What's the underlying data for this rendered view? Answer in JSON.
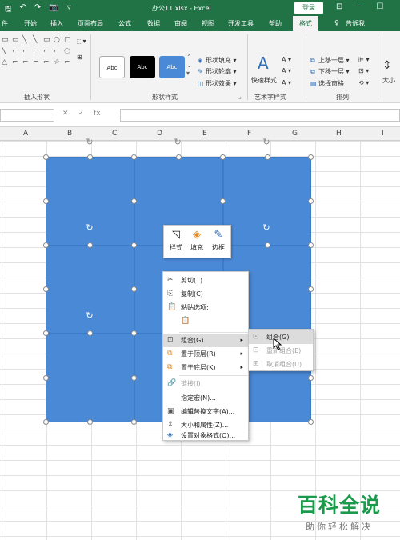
{
  "titlebar": {
    "title": "办公11.xlsx - Excel",
    "login_label": "登录",
    "qat": [
      "🖫",
      "↶",
      "↷",
      "📷",
      "▿"
    ],
    "window_buttons": [
      "⊡",
      "─",
      "☐"
    ]
  },
  "tabs": [
    {
      "label": "件"
    },
    {
      "label": "开始"
    },
    {
      "label": "插入"
    },
    {
      "label": "页面布局"
    },
    {
      "label": "公式"
    },
    {
      "label": "数据"
    },
    {
      "label": "审阅"
    },
    {
      "label": "视图"
    },
    {
      "label": "开发工具"
    },
    {
      "label": "帮助"
    },
    {
      "label": "格式",
      "active": true
    },
    {
      "label": "告诉我"
    }
  ],
  "ribbon": {
    "group_insert_shapes": "插入形状",
    "group_shape_styles": "形状样式",
    "group_wordart": "艺术字样式",
    "group_arrange": "排列",
    "style_samples": [
      "Abc",
      "Abc",
      "Abc"
    ],
    "shape_fill": "形状填充",
    "shape_outline": "形状轮廓",
    "shape_effects": "形状效果",
    "quick_styles": "快速样式",
    "bring_forward": "上移一层",
    "send_backward": "下移一层",
    "selection_pane": "选择窗格",
    "size": "大小",
    "gallery_shapes": [
      "▭",
      "▭",
      "╲",
      "╲",
      "▭",
      "○",
      "▢",
      "╲",
      "⌐",
      "⌐",
      "⌐",
      "⌐",
      "⌐",
      "◌",
      "△",
      "⌐",
      "⌐",
      "⌐",
      "⌐",
      "☆",
      "⌐",
      "⌐",
      "⌐",
      "⌐",
      "⌐",
      "{",
      "}",
      "⌐"
    ]
  },
  "columns": [
    "A",
    "B",
    "C",
    "D",
    "E",
    "F",
    "G",
    "H",
    "I"
  ],
  "mini_toolbar": {
    "style_label": "样式",
    "fill_label": "填充",
    "border_label": "边框"
  },
  "context_menu": {
    "cut": "剪切(T)",
    "copy": "复制(C)",
    "paste_options": "粘贴选项:",
    "group": "组合(G)",
    "bring_to_front": "置于顶层(R)",
    "send_to_back": "置于底层(K)",
    "link": "链接(I)",
    "assign_macro": "指定宏(N)...",
    "edit_alt_text": "编辑替换文字(A)...",
    "size_properties": "大小和属性(Z)...",
    "format_object": "设置对象格式(O)..."
  },
  "submenu": {
    "group": "组合(G)",
    "regroup": "重新组合(E)",
    "ungroup": "取消组合(U)"
  },
  "watermark": {
    "title": "百科全说",
    "subtitle": "助你轻松解决"
  },
  "colors": {
    "excel_green": "#217346",
    "shape_blue": "#4a89d6",
    "watermark_green": "#1a9a4b"
  }
}
